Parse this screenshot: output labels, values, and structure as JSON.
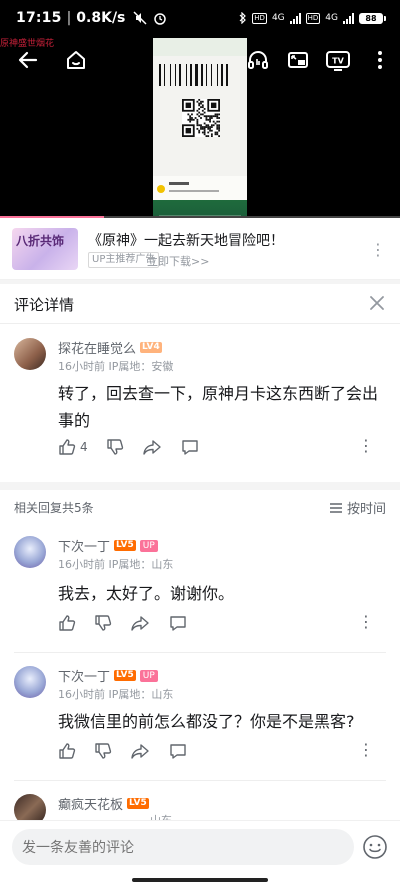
{
  "status_bar": {
    "time": "17:15",
    "network_speed": "0.8K/s",
    "battery": "88",
    "signal_labels": [
      "HD",
      "4G",
      "HD",
      "4G"
    ]
  },
  "video": {
    "overlay_text": "原神盛世烟花",
    "progress_fraction": 0.26
  },
  "ad": {
    "thumb_text": "八折共饰",
    "title": "《原神》一起去新天地冒险吧！",
    "badge": "UP主推荐广告",
    "download": "立即下载>>"
  },
  "sheet": {
    "title": "评论详情"
  },
  "main_comment": {
    "username": "探花在睡觉么",
    "level": "LV4",
    "time": "16小时前",
    "ip": "IP属地：安徽",
    "text": "转了，回去查一下，原神月卡这东西断了会出事的",
    "likes": "4"
  },
  "replies_header": {
    "count_label": "相关回复共5条",
    "sort_label": "按时间"
  },
  "replies": [
    {
      "username": "下次一丁",
      "level": "LV5",
      "badge": "UP",
      "time": "16小时前",
      "ip": "IP属地：山东",
      "text": "我去，太好了。谢谢你。"
    },
    {
      "username": "下次一丁",
      "level": "LV5",
      "badge": "UP",
      "time": "16小时前",
      "ip": "IP属地：山东",
      "text": "我微信里的前怎么都没了？你是不是黑客?"
    },
    {
      "username": "癫疯天花板",
      "level": "LV5",
      "time": "",
      "ip": "山东",
      "text": ""
    }
  ],
  "composer": {
    "placeholder": "发一条友善的评论"
  },
  "colors": {
    "brand_pink": "#fb7299",
    "lv4": "#ffb37c",
    "lv5": "#ff6c00"
  },
  "icons": [
    "back-icon",
    "home-icon",
    "headphone-icon",
    "pip-icon",
    "tv-cast-icon",
    "more-vertical-icon",
    "close-icon",
    "like-icon",
    "dislike-icon",
    "share-icon",
    "comment-icon",
    "sort-icon",
    "emoji-icon"
  ]
}
